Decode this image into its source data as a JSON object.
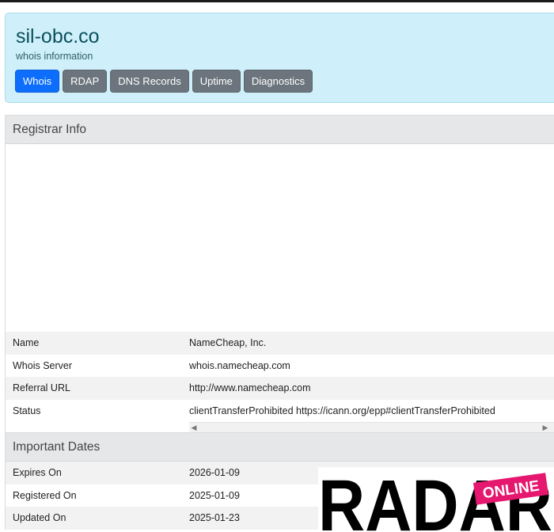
{
  "header": {
    "domain": "sil-obc.co",
    "subtitle": "whois information",
    "tabs": [
      {
        "label": "Whois",
        "active": true
      },
      {
        "label": "RDAP",
        "active": false
      },
      {
        "label": "DNS Records",
        "active": false
      },
      {
        "label": "Uptime",
        "active": false
      },
      {
        "label": "Diagnostics",
        "active": false
      }
    ]
  },
  "registrar": {
    "title": "Registrar Info",
    "rows": [
      {
        "label": "Name",
        "value": "NameCheap, Inc."
      },
      {
        "label": "Whois Server",
        "value": "whois.namecheap.com"
      },
      {
        "label": "Referral URL",
        "value": "http://www.namecheap.com"
      },
      {
        "label": "Status",
        "value": "clientTransferProhibited https://icann.org/epp#clientTransferProhibited"
      }
    ]
  },
  "dates": {
    "title": "Important Dates",
    "rows": [
      {
        "label": "Expires On",
        "value": "2026-01-09"
      },
      {
        "label": "Registered On",
        "value": "2025-01-09"
      },
      {
        "label": "Updated On",
        "value": "2025-01-23"
      }
    ]
  },
  "watermark": {
    "text_main": "RADAR",
    "text_badge": "ONLINE",
    "badge_color": "#e6176f"
  },
  "colors": {
    "header_bg": "#cff0fa",
    "active_tab": "#0d6efd",
    "inactive_tab": "#6c757d"
  }
}
